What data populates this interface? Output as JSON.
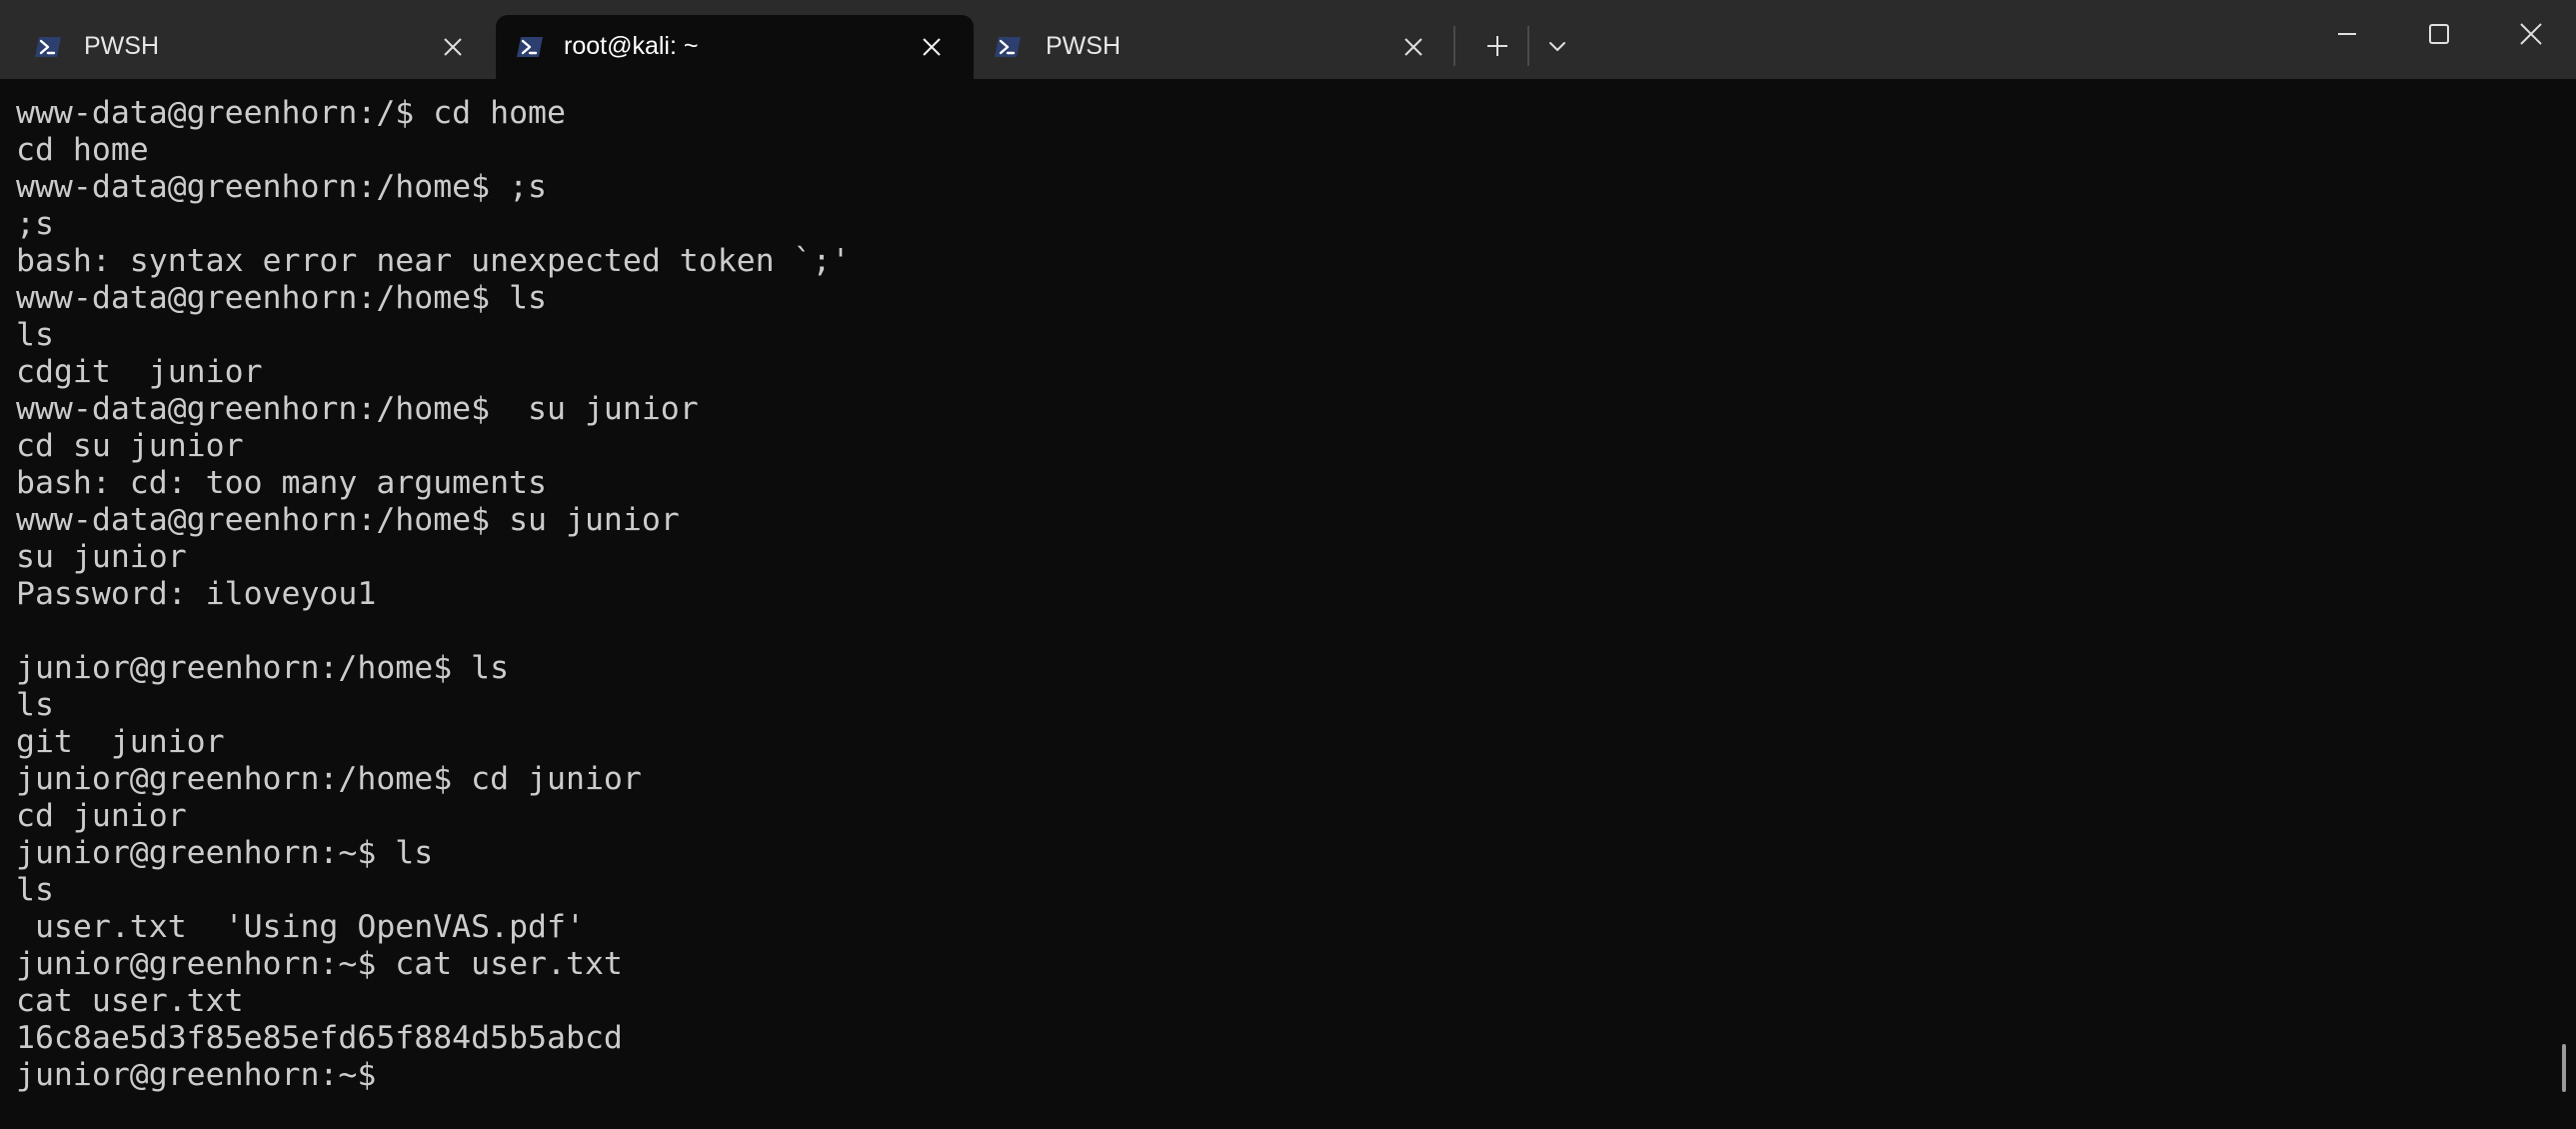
{
  "tabs": [
    {
      "label": "PWSH",
      "icon": "powershell-icon",
      "active": false
    },
    {
      "label": "root@kali: ~",
      "icon": "powershell-icon",
      "active": true
    },
    {
      "label": "PWSH",
      "icon": "powershell-icon",
      "active": false
    }
  ],
  "icons": {
    "tab_close": "close-icon",
    "new_tab": "plus-icon",
    "dropdown": "chevron-down-icon",
    "minimize": "minimize-icon",
    "maximize": "maximize-icon",
    "window_close": "close-icon"
  },
  "colors": {
    "terminal_background": "#0c0c0c",
    "terminal_foreground": "#cccccc",
    "titlebar_background": "#2b2b2b"
  },
  "terminal": {
    "lines": [
      "www-data@greenhorn:/$ cd home",
      "cd home",
      "www-data@greenhorn:/home$ ;s",
      ";s",
      "bash: syntax error near unexpected token `;'",
      "www-data@greenhorn:/home$ ls",
      "ls",
      "cdgit  junior",
      "www-data@greenhorn:/home$  su junior",
      "cd su junior",
      "bash: cd: too many arguments",
      "www-data@greenhorn:/home$ su junior",
      "su junior",
      "Password: iloveyou1",
      "",
      "junior@greenhorn:/home$ ls",
      "ls",
      "git  junior",
      "junior@greenhorn:/home$ cd junior",
      "cd junior",
      "junior@greenhorn:~$ ls",
      "ls",
      " user.txt  'Using OpenVAS.pdf'",
      "junior@greenhorn:~$ cat user.txt",
      "cat user.txt",
      "16c8ae5d3f85e85efd65f884d5b5abcd",
      "junior@greenhorn:~$ "
    ]
  }
}
